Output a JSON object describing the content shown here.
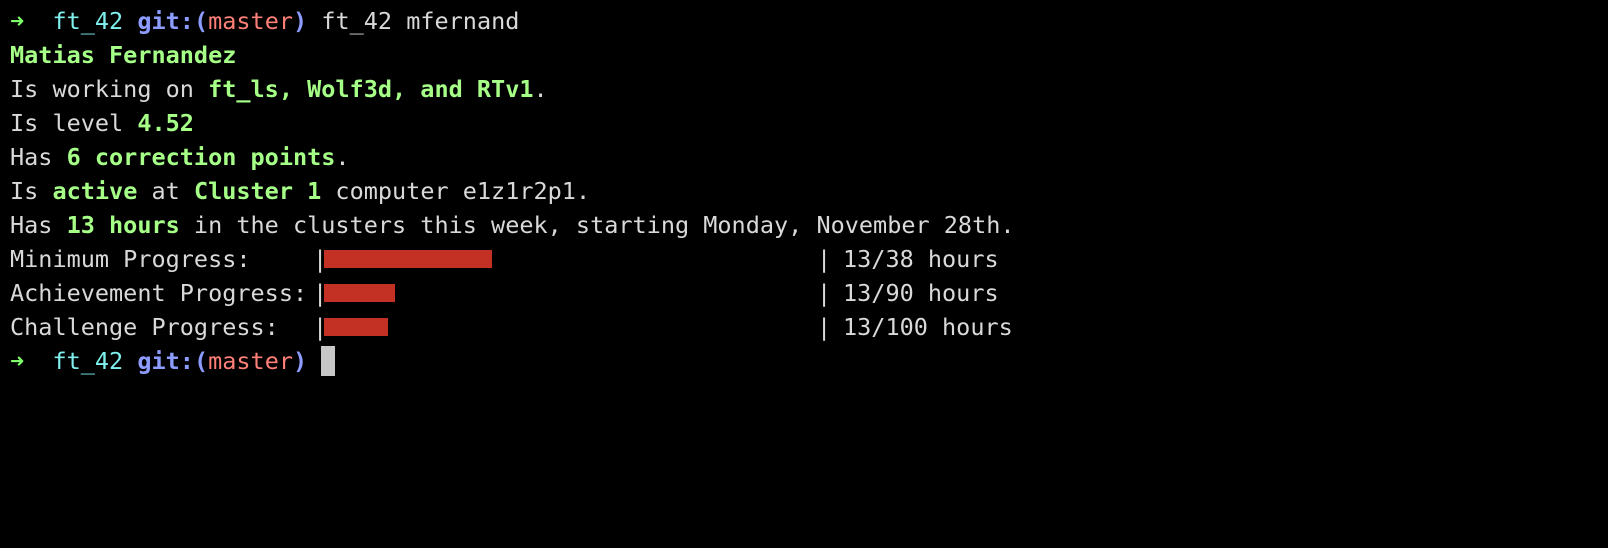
{
  "prompt": {
    "arrow": "➜",
    "dir": "ft_42",
    "git_prefix": "git:(",
    "branch": "master",
    "git_suffix": ")"
  },
  "command": "ft_42 mfernand",
  "user": {
    "name": "Matias Fernandez",
    "projects_prefix": "Is working on ",
    "projects": "ft_ls, Wolf3d, and RTv1",
    "projects_suffix": ".",
    "level_prefix": "Is level ",
    "level": "4.52",
    "points_prefix": "Has ",
    "points": "6 correction points",
    "points_suffix": ".",
    "status_prefix": "Is ",
    "status": "active",
    "status_mid": " at ",
    "cluster": "Cluster 1",
    "computer_text": " computer e1z1r2p1.",
    "hours_prefix": "Has ",
    "hours": "13 hours",
    "hours_suffix": " in the clusters this week, starting Monday, November 28th."
  },
  "progress": [
    {
      "label": "Minimum Progress:",
      "value_text": "13/38 hours",
      "fraction": 0.342
    },
    {
      "label": "Achievement Progress:",
      "value_text": "13/90 hours",
      "fraction": 0.144
    },
    {
      "label": "Challenge Progress:",
      "value_text": "13/100 hours",
      "fraction": 0.13
    }
  ],
  "pipe": "|",
  "colors": {
    "background": "#000000",
    "highlight_green": "#a6ff87",
    "arrow_green": "#7fff6a",
    "dir_cyan": "#7ff0ee",
    "git_blue": "#8d9cff",
    "branch_red": "#ff8078",
    "bar_red": "#c23124",
    "text": "#d9d9d9"
  }
}
